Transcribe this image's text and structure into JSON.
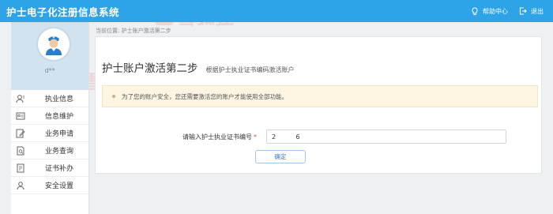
{
  "app": {
    "title": "护士电子化注册信息系统"
  },
  "topbar": {
    "actions": [
      {
        "label": "帮助中心",
        "icon": "lightbulb-icon"
      },
      {
        "label": "退出",
        "icon": "logout-icon"
      }
    ]
  },
  "sidebar": {
    "username": "d**",
    "items": [
      {
        "label": "执业信息",
        "icon": "user-profile-icon"
      },
      {
        "label": "信息维护",
        "icon": "id-card-icon"
      },
      {
        "label": "业务申请",
        "icon": "edit-form-icon"
      },
      {
        "label": "业务查询",
        "icon": "search-doc-icon"
      },
      {
        "label": "证书补办",
        "icon": "certificate-icon"
      },
      {
        "label": "安全设置",
        "icon": "shield-user-icon"
      }
    ]
  },
  "breadcrumb": "当前位置: 护士账户激活第二步",
  "page": {
    "title": "护士账户激活第二步",
    "subtitle": "根据护士执业证书编码激活账户",
    "notice": "为了您的账户安全，您还需要激活您的账户才能使用全部功能。"
  },
  "form": {
    "cert_label": "请输入护士执业证书编号",
    "required_mark": "*",
    "cert_value": "2          6",
    "confirm_label": "确定"
  },
  "watermark": {
    "text": "雪狐狸"
  },
  "colors": {
    "topbar": "#2ea3e8",
    "sidebar_profile": "#d2e2ef",
    "notice_bg": "#fdf5e2"
  }
}
